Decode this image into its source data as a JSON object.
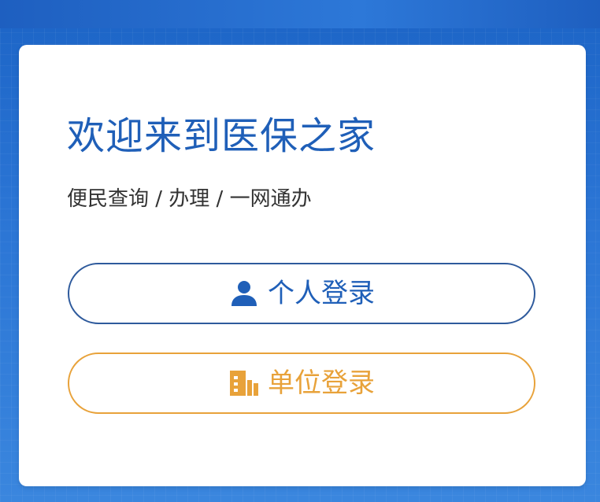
{
  "colors": {
    "primary_blue": "#1f5fb8",
    "accent_orange": "#e8a23a",
    "card_bg": "#ffffff"
  },
  "welcome": {
    "title": "欢迎来到医保之家",
    "subtitle": "便民查询 / 办理 / 一网通办"
  },
  "buttons": {
    "personal_login": {
      "label": "个人登录",
      "icon": "user-icon"
    },
    "unit_login": {
      "label": "单位登录",
      "icon": "building-icon"
    }
  }
}
